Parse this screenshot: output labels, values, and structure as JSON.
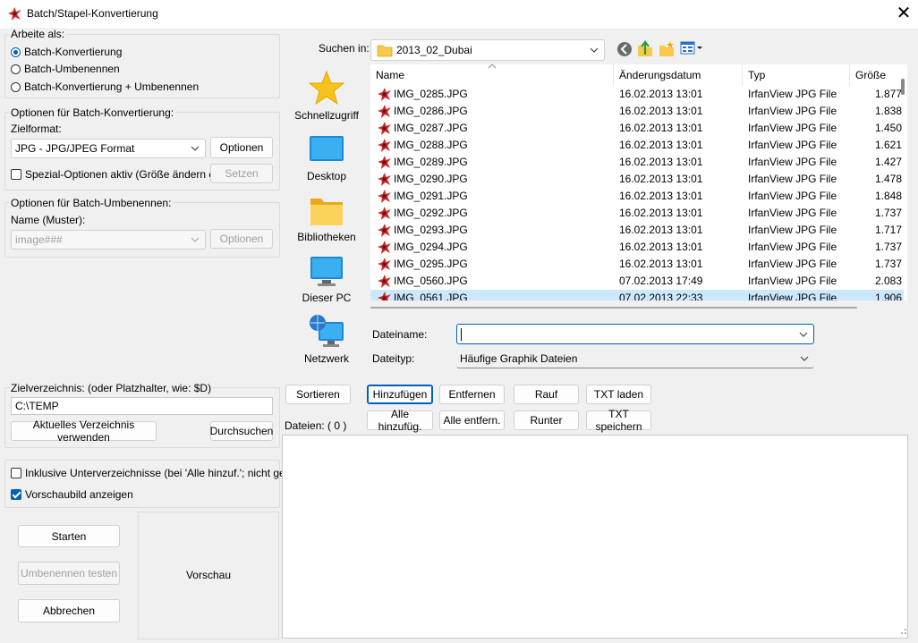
{
  "window": {
    "title": "Batch/Stapel-Konvertierung",
    "close_glyph": "✕"
  },
  "work_as": {
    "legend": "Arbeite als:",
    "options": [
      {
        "label": "Batch-Konvertierung",
        "selected": true
      },
      {
        "label": "Batch-Umbenennen",
        "selected": false
      },
      {
        "label": "Batch-Konvertierung + Umbenennen",
        "selected": false
      }
    ]
  },
  "convert_options": {
    "legend": "Optionen für Batch-Konvertierung:",
    "target_format_label": "Zielformat:",
    "target_format_value": "JPG - JPG/JPEG Format",
    "options_button": "Optionen",
    "special_options_label": "Spezial-Optionen aktiv (Größe ändern etc.)",
    "special_options_checked": false,
    "set_button": "Setzen"
  },
  "rename_options": {
    "legend": "Optionen für Batch-Umbenennen:",
    "name_label": "Name (Muster):",
    "name_value": "image###",
    "options_button": "Optionen"
  },
  "target_dir": {
    "legend": "Zielverzeichnis: (oder Platzhalter, wie: $D)",
    "value": "C:\\TEMP",
    "use_current_button": "Aktuelles Verzeichnis verwenden",
    "browse_button": "Durchsuchen"
  },
  "extra": {
    "include_subdirs_label": "Inklusive Unterverzeichnisse (bei 'Alle hinzuf.'; nicht gesp.)",
    "include_subdirs_checked": false,
    "show_preview_label": "Vorschaubild anzeigen",
    "show_preview_checked": true
  },
  "actions": {
    "start": "Starten",
    "test_rename": "Umbenennen testen",
    "cancel": "Abbrechen"
  },
  "preview": {
    "label": "Vorschau"
  },
  "browser": {
    "search_in_label": "Suchen in:",
    "folder": "2013_02_Dubai",
    "places": [
      "Schnellzugriff",
      "Desktop",
      "Bibliotheken",
      "Dieser PC",
      "Netzwerk"
    ],
    "columns": [
      "Name",
      "Änderungsdatum",
      "Typ",
      "Größe"
    ],
    "files": [
      {
        "name": "IMG_0285.JPG",
        "date": "16.02.2013 13:01",
        "type": "IrfanView JPG File",
        "size": "1.877"
      },
      {
        "name": "IMG_0286.JPG",
        "date": "16.02.2013 13:01",
        "type": "IrfanView JPG File",
        "size": "1.838"
      },
      {
        "name": "IMG_0287.JPG",
        "date": "16.02.2013 13:01",
        "type": "IrfanView JPG File",
        "size": "1.450"
      },
      {
        "name": "IMG_0288.JPG",
        "date": "16.02.2013 13:01",
        "type": "IrfanView JPG File",
        "size": "1.621"
      },
      {
        "name": "IMG_0289.JPG",
        "date": "16.02.2013 13:01",
        "type": "IrfanView JPG File",
        "size": "1.427"
      },
      {
        "name": "IMG_0290.JPG",
        "date": "16.02.2013 13:01",
        "type": "IrfanView JPG File",
        "size": "1.478"
      },
      {
        "name": "IMG_0291.JPG",
        "date": "16.02.2013 13:01",
        "type": "IrfanView JPG File",
        "size": "1.848"
      },
      {
        "name": "IMG_0292.JPG",
        "date": "16.02.2013 13:01",
        "type": "IrfanView JPG File",
        "size": "1.737"
      },
      {
        "name": "IMG_0293.JPG",
        "date": "16.02.2013 13:01",
        "type": "IrfanView JPG File",
        "size": "1.717"
      },
      {
        "name": "IMG_0294.JPG",
        "date": "16.02.2013 13:01",
        "type": "IrfanView JPG File",
        "size": "1.737"
      },
      {
        "name": "IMG_0295.JPG",
        "date": "16.02.2013 13:01",
        "type": "IrfanView JPG File",
        "size": "1.737"
      },
      {
        "name": "IMG_0560.JPG",
        "date": "07.02.2013 17:49",
        "type": "IrfanView JPG File",
        "size": "2.083"
      },
      {
        "name": "IMG_0561.JPG",
        "date": "07.02.2013 22:33",
        "type": "IrfanView JPG File",
        "size": "1.906"
      }
    ],
    "filename_label": "Dateiname:",
    "filename_value": "",
    "filetype_label": "Dateityp:",
    "filetype_value": "Häufige Graphik Dateien"
  },
  "list_buttons": {
    "sort": "Sortieren",
    "add": "Hinzufügen",
    "remove": "Entfernen",
    "up": "Rauf",
    "load_txt": "TXT laden",
    "add_all": "Alle hinzufüg.",
    "remove_all": "Alle entfern.",
    "down": "Runter",
    "save_txt": "TXT speichern"
  },
  "files_count": {
    "label": "Dateien:",
    "count": "( 0 )"
  },
  "colors": {
    "accent": "#005fb8",
    "selection": "#cce8ff",
    "folder": "#f8c94a"
  },
  "icons": [
    "app-irfanview-icon",
    "close-icon",
    "back-icon",
    "up-folder-icon",
    "new-folder-icon",
    "view-menu-icon",
    "star-icon",
    "desktop-icon",
    "libraries-icon",
    "this-pc-icon",
    "network-icon",
    "jpg-file-icon",
    "chevron-down-icon"
  ]
}
